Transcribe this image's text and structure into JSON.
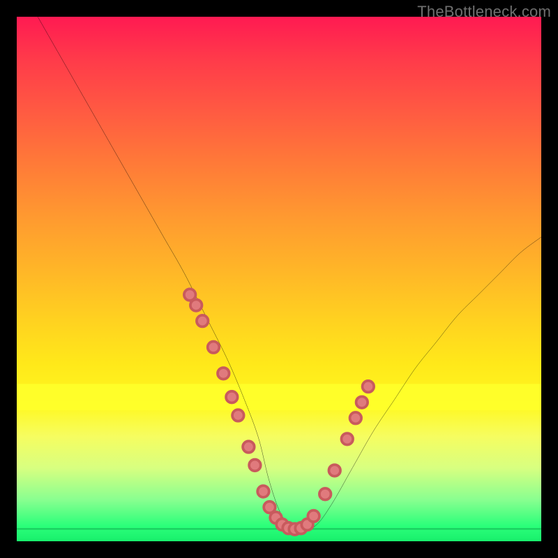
{
  "watermark": "TheBottleneck.com",
  "chart_data": {
    "type": "line",
    "title": "",
    "xlabel": "",
    "ylabel": "",
    "xlim": [
      0,
      100
    ],
    "ylim": [
      0,
      100
    ],
    "series": [
      {
        "name": "curve",
        "x": [
          4,
          8,
          12,
          16,
          20,
          24,
          28,
          32,
          36,
          40,
          43,
          46,
          48,
          50,
          52,
          54,
          57,
          60,
          64,
          68,
          72,
          76,
          80,
          84,
          88,
          92,
          96,
          100
        ],
        "y": [
          100,
          93,
          86,
          79,
          72,
          65,
          58,
          51,
          43,
          35,
          28,
          20,
          12,
          6,
          3,
          2,
          3,
          7,
          14,
          21,
          27,
          33,
          38,
          43,
          47,
          51,
          55,
          58
        ]
      }
    ],
    "markers": {
      "name": "highlight-dots",
      "x": [
        33,
        34.2,
        35.4,
        37.5,
        39.4,
        41,
        42.2,
        44.2,
        45.4,
        47,
        48.2,
        49.4,
        50.6,
        51.8,
        53,
        54.2,
        55.4,
        56.6,
        58.8,
        60.6,
        63,
        64.6,
        65.8,
        67
      ],
      "y": [
        47,
        45,
        42,
        37,
        32,
        27.5,
        24,
        18,
        14.5,
        9.5,
        6.5,
        4.5,
        3.2,
        2.5,
        2.3,
        2.5,
        3.2,
        4.8,
        9,
        13.5,
        19.5,
        23.5,
        26.5,
        29.5
      ]
    },
    "bands": [
      {
        "name": "yellow-band",
        "y0": 25,
        "y1": 30,
        "color": "#ffff2a"
      },
      {
        "name": "green-line",
        "y0": 2.2,
        "y1": 2.5,
        "color": "#18c85c"
      }
    ]
  }
}
